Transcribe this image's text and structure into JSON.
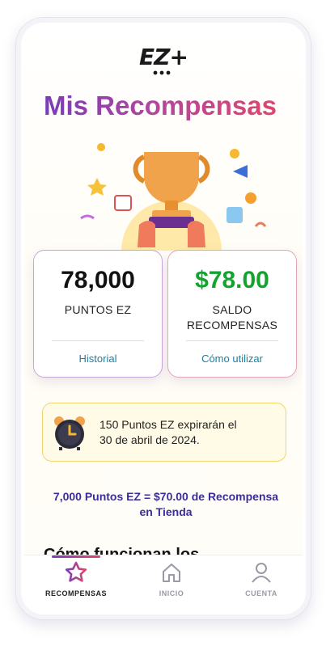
{
  "brand": {
    "logo_text": "EZ+"
  },
  "header": {
    "title": "Mis Recompensas"
  },
  "cards": {
    "points": {
      "value": "78,000",
      "label": "PUNTOS EZ",
      "link": "Historial"
    },
    "balance": {
      "value": "$78.00",
      "label_line1": "SALDO",
      "label_line2": "RECOMPENSAS",
      "link": "Cómo utilizar"
    }
  },
  "notice": {
    "line1": "150 Puntos EZ expirarán el",
    "line2": "30 de abril de 2024."
  },
  "conversion": {
    "line1": "7,000 Puntos EZ = $70.00 de Recompensa",
    "line2": "en Tienda"
  },
  "section": {
    "partial_heading": "Cómo funcionan los"
  },
  "tabs": [
    {
      "label": "RECOMPENSAS",
      "icon": "star-icon",
      "active": true
    },
    {
      "label": "INICIO",
      "icon": "home-icon",
      "active": false
    },
    {
      "label": "CUENTA",
      "icon": "user-icon",
      "active": false
    }
  ],
  "colors": {
    "accent_purple": "#7a3db8",
    "accent_pink": "#e0466c",
    "green": "#14a32f",
    "link_blue": "#1a7fa3"
  }
}
